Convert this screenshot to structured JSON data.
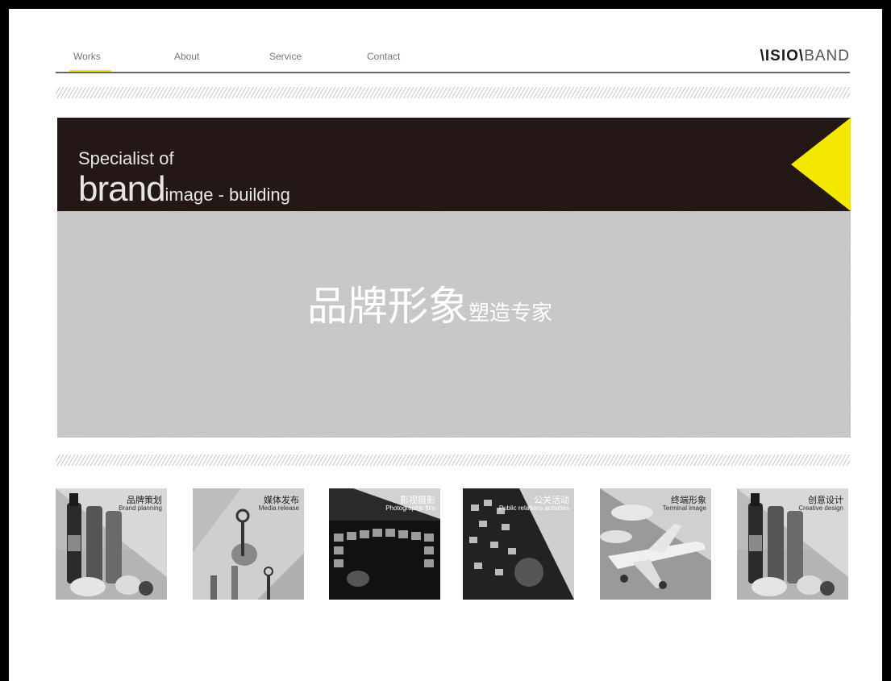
{
  "nav": {
    "items": [
      {
        "label": "Works"
      },
      {
        "label": "About"
      },
      {
        "label": "Service"
      },
      {
        "label": "Contact"
      }
    ],
    "logo_bold": "\\ISIO\\",
    "logo_light": "BAND"
  },
  "hero": {
    "tagline_small": "Specialist of",
    "tagline_big": "brand",
    "tagline_rest": "image - building",
    "cn_big": "品牌形象",
    "cn_small": "塑造专家",
    "accent_color": "#f5e800",
    "dark_color": "#231816"
  },
  "services": [
    {
      "cn": "品牌策划",
      "en": "Brand planning",
      "icon": "wine-bottle-photo"
    },
    {
      "cn": "媒体发布",
      "en": "Media release",
      "icon": "keys-photo"
    },
    {
      "cn": "影视摄影",
      "en": "Photographic film",
      "icon": "screens-photo"
    },
    {
      "cn": "公关活动",
      "en": "Public relations activities",
      "icon": "event-photo"
    },
    {
      "cn": "终端形象",
      "en": "Terminal image",
      "icon": "airplane-photo"
    },
    {
      "cn": "创意设计",
      "en": "Creative design",
      "icon": "wine-bottle-photo"
    }
  ]
}
